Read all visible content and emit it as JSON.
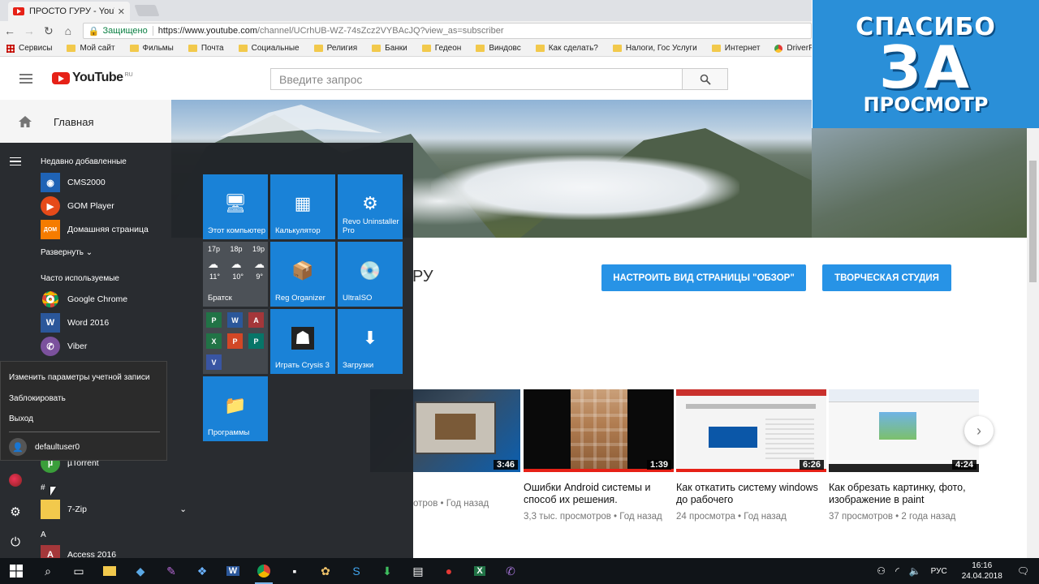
{
  "browser": {
    "tab_title": "ПРОСТО ГУРУ - YouTube",
    "tab_close": "✕",
    "secure_label": "Защищено",
    "url_host": "https://www.youtube.com",
    "url_rest": "/channel/UCrhUB-WZ-74sZcz2VYBAcJQ?view_as=subscriber",
    "bookmarks": [
      "Сервисы",
      "Мой сайт",
      "Фильмы",
      "Почта",
      "Социальные",
      "Религия",
      "Банки",
      "Гедеон",
      "Виндовс",
      "Как сделать?",
      "Налоги, Гос Услуги",
      "Интернет",
      "DriverPack Solution"
    ]
  },
  "youtube": {
    "logo_text": "YouTube",
    "logo_region": "RU",
    "search_placeholder": "Введите запрос",
    "sidebar_home": "Главная",
    "channel_name_fragment": "РУ",
    "customize_button": "НАСТРОИТЬ ВИД СТРАНИЦЫ \"ОБЗОР\"",
    "studio_button": "ТВОРЧЕСКАЯ СТУДИЯ",
    "videos": [
      {
        "duration": "3:46",
        "title": "",
        "meta": "отров • Год назад"
      },
      {
        "duration": "1:39",
        "title": "Ошибки Android системы и способ их решения.",
        "meta": "3,3 тыс. просмотров • Год назад"
      },
      {
        "duration": "6:26",
        "title": "Как откатить систему windows до рабочего",
        "meta": "24 просмотра • Год назад"
      },
      {
        "duration": "4:24",
        "title": "Как обрезать картинку, фото, изображение в paint",
        "meta": "37 просмотров • 2 года назад"
      }
    ],
    "next_arrow": "›"
  },
  "overlay": {
    "line1": "СПАСИБО",
    "line2": "ЗА",
    "line3": "ПРОСМОТР"
  },
  "start_menu": {
    "recent_header": "Недавно добавленные",
    "recent_apps": [
      "CMS2000",
      "GOM Player",
      "Домашняя страница"
    ],
    "expand_label": "Развернуть",
    "frequent_header": "Часто используемые",
    "frequent_apps": [
      "Google Chrome",
      "Word 2016",
      "Viber"
    ],
    "account_menu": {
      "change_settings": "Изменить параметры учетной записи",
      "lock": "Заблокировать",
      "sign_out": "Выход",
      "username": "defaultuser0"
    },
    "list_more": [
      "µTorrent",
      "#",
      "7-Zip",
      "A",
      "Access 2016"
    ],
    "tiles": {
      "this_pc": "Этот компьютер",
      "calculator": "Калькулятор",
      "revo": "Revo Uninstaller Pro",
      "weather_days": [
        "17р",
        "18р",
        "19р"
      ],
      "weather_temps": [
        "11°",
        "10°",
        "9°"
      ],
      "weather_city": "Братск",
      "reg_organizer": "Reg Organizer",
      "ultraiso": "UltraISO",
      "crysis": "Играть Crysis 3",
      "downloads": "Загрузки",
      "programs": "Программы"
    }
  },
  "taskbar": {
    "language": "РУС",
    "time": "16:16",
    "date": "24.04.2018"
  },
  "colors": {
    "accent_blue": "#2793e6",
    "tile_blue": "#1a82d7",
    "yt_red": "#e62117"
  }
}
